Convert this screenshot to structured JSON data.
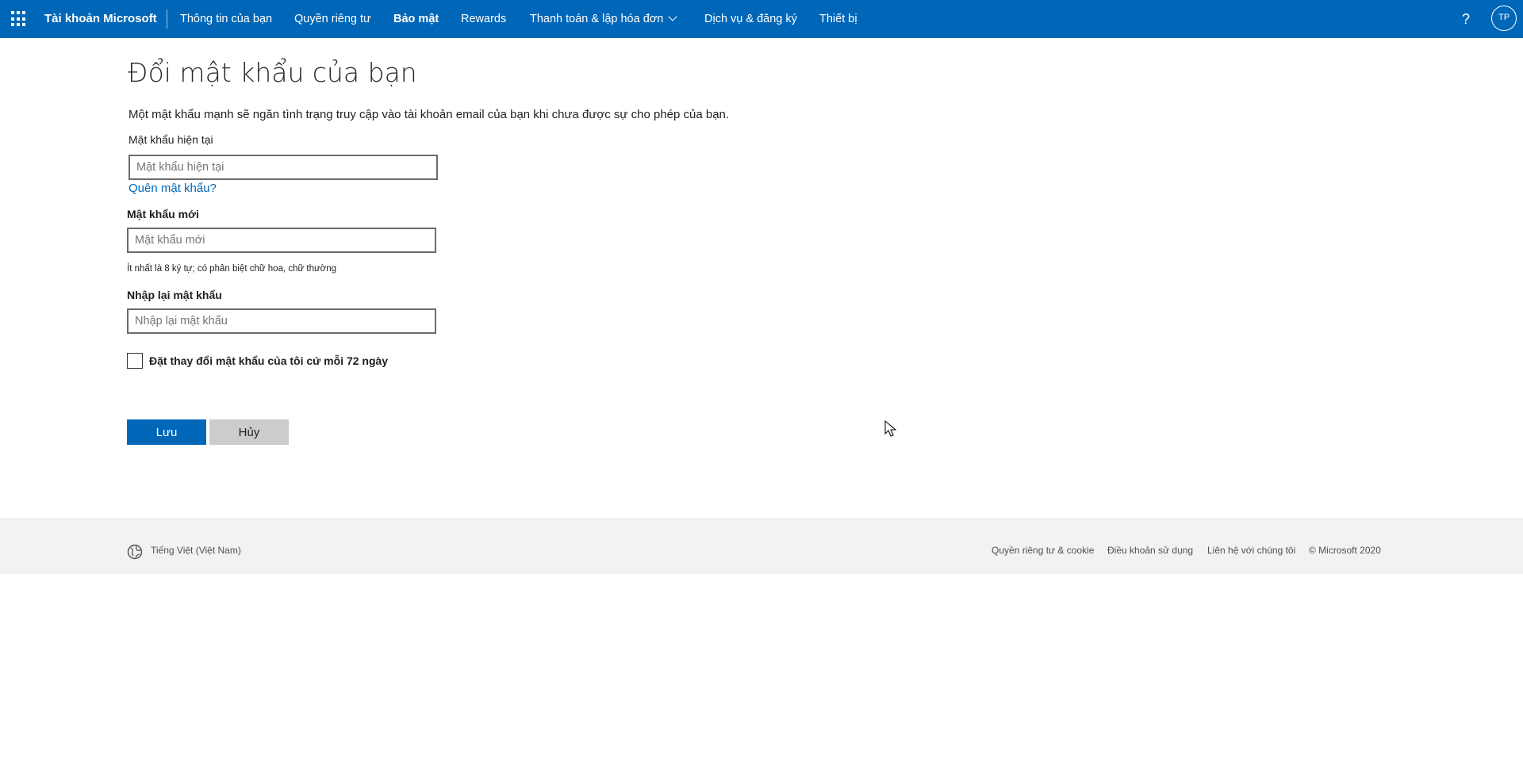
{
  "header": {
    "brand": "Tài khoản Microsoft",
    "nav": [
      {
        "label": "Thông tin của bạn"
      },
      {
        "label": "Quyền riêng tư"
      },
      {
        "label": "Bảo mật"
      },
      {
        "label": "Rewards"
      },
      {
        "label": "Thanh toán & lập hóa đơn"
      },
      {
        "label": "Dịch vụ & đăng ký"
      },
      {
        "label": "Thiết bị"
      }
    ],
    "help": "?",
    "avatar_initials": "TP"
  },
  "form": {
    "title": "Đổi mật khẩu của bạn",
    "description": "Một mật khẩu mạnh sẽ ngăn tình trạng truy cập vào tài khoản email của bạn khi chưa được sự cho phép của bạn.",
    "current_label": "Mật khẩu hiện tại",
    "current_placeholder": "Mật khẩu hiện tại",
    "forgot_link": "Quên mật khẩu?",
    "new_label": "Mật khẩu mới",
    "new_placeholder": "Mật khẩu mới",
    "hint": "Ít nhất là 8 ký tự; có phân biệt chữ hoa, chữ thường",
    "confirm_label": "Nhập lại mật khẩu",
    "confirm_placeholder": "Nhập lại mật khẩu",
    "checkbox_label": "Đặt thay đổi mật khẩu của tôi cứ mỗi 72 ngày",
    "checkbox_checked": false,
    "save_label": "Lưu",
    "cancel_label": "Hủy"
  },
  "footer": {
    "language": "Tiếng Việt (Việt Nam)",
    "links": [
      {
        "label": "Quyền riêng tư & cookie"
      },
      {
        "label": "Điều khoản sử dụng"
      },
      {
        "label": "Liên hệ với chúng tôi"
      },
      {
        "label": "© Microsoft 2020"
      }
    ]
  },
  "colors": {
    "brand_blue": "#0067b8",
    "footer_bg": "#f2f2f2",
    "cancel_bg": "#cccccc"
  },
  "icons": {
    "app_launcher": "waffle-icon",
    "chevron": "chevron-down-icon",
    "language": "globe-icon",
    "pointer": "mouse-cursor-icon"
  }
}
